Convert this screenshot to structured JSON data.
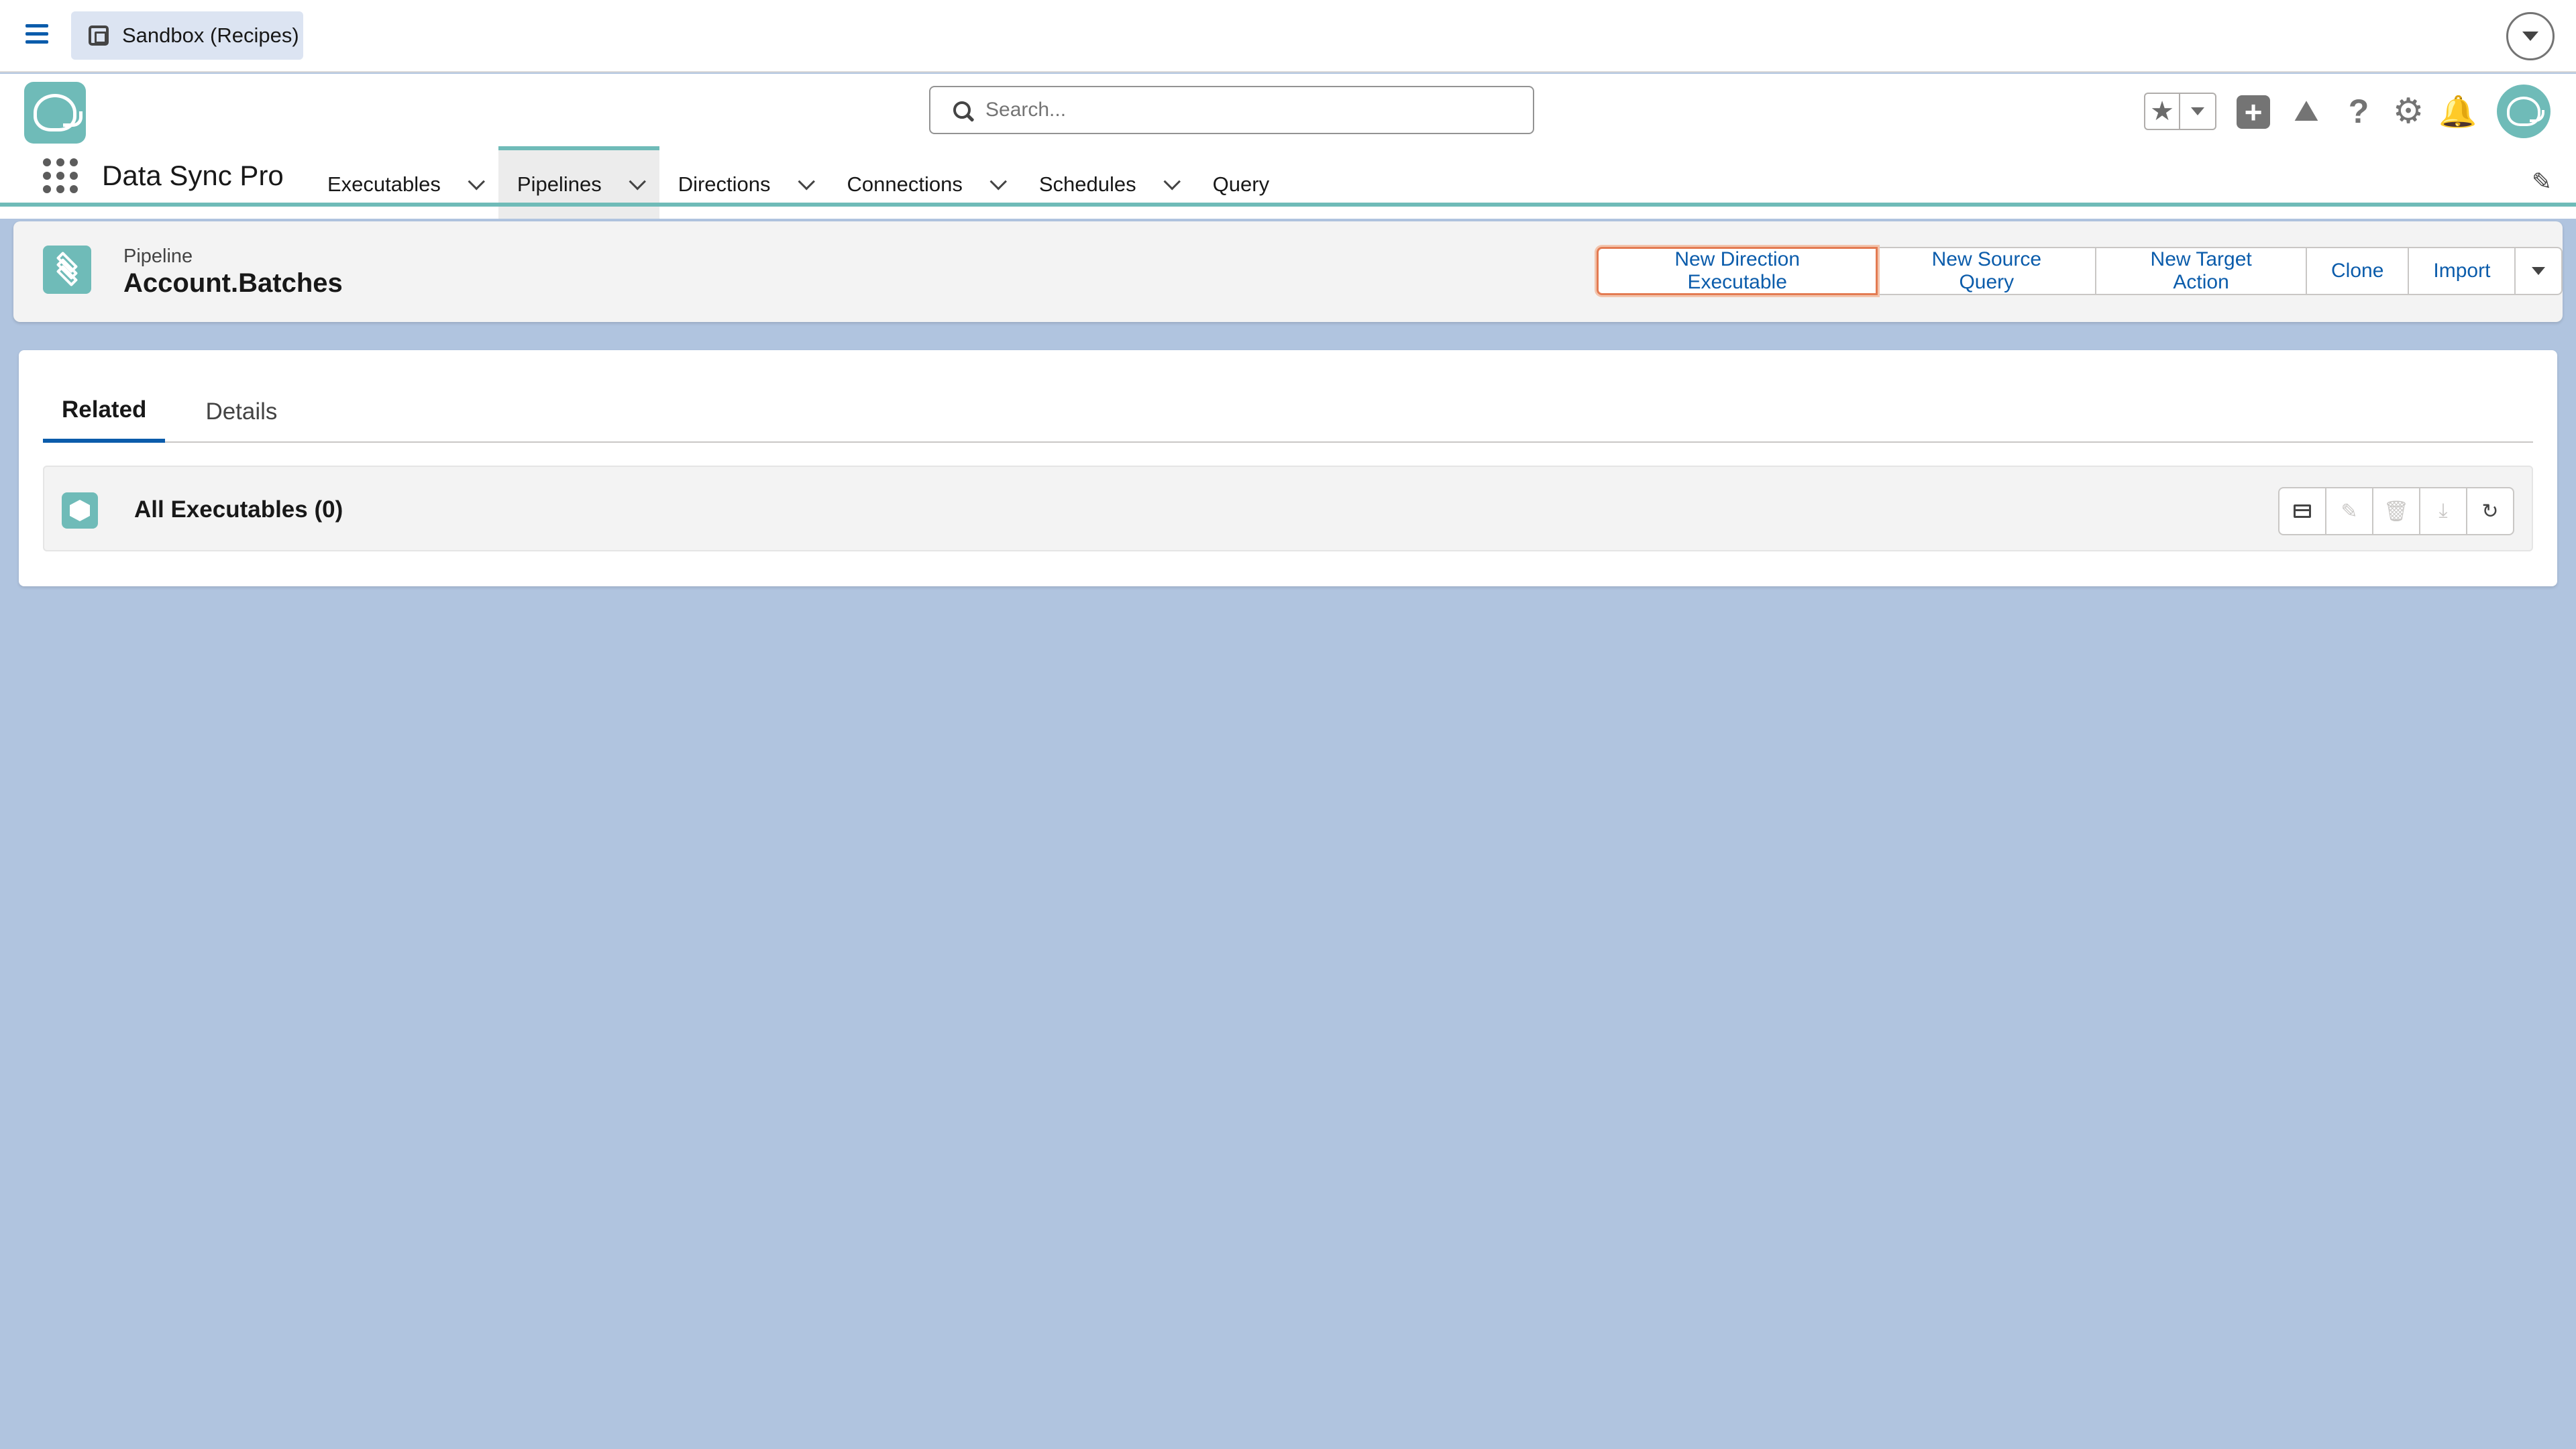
{
  "sandbox": {
    "label": "Sandbox (Recipes)"
  },
  "header": {
    "search_placeholder": "Search...",
    "app_name": "Data Sync Pro"
  },
  "nav": {
    "items": [
      {
        "label": "Executables",
        "has_menu": true,
        "active": false
      },
      {
        "label": "Pipelines",
        "has_menu": true,
        "active": true
      },
      {
        "label": "Directions",
        "has_menu": true,
        "active": false
      },
      {
        "label": "Connections",
        "has_menu": true,
        "active": false
      },
      {
        "label": "Schedules",
        "has_menu": true,
        "active": false
      },
      {
        "label": "Query",
        "has_menu": false,
        "active": false
      }
    ]
  },
  "record": {
    "type": "Pipeline",
    "title": "Account.Batches",
    "actions": [
      "New Direction Executable",
      "New Source Query",
      "New Target Action",
      "Clone",
      "Import"
    ]
  },
  "tabs": [
    {
      "label": "Related",
      "active": true
    },
    {
      "label": "Details",
      "active": false
    }
  ],
  "related_list": {
    "title": "All Executables (0)"
  },
  "colors": {
    "brand_teal": "#6fbbb8",
    "link_blue": "#0b5cab",
    "page_background": "#b0c4df",
    "highlight_outline": "#e37b52"
  }
}
